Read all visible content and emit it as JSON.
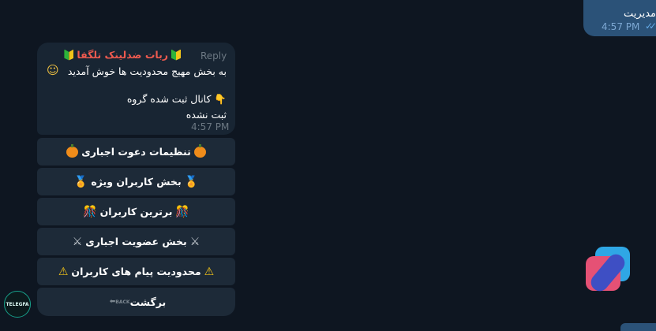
{
  "outgoing": {
    "text": "مدیریت",
    "time": "4:57 PM",
    "status": "read"
  },
  "avatar": {
    "label": "TELEGFA"
  },
  "message": {
    "reply_label": "Reply",
    "sender": "ربات ضدلینک تلگفا",
    "line1": "به بخش مهیج محدودیت ها خوش آمدید",
    "line2": "کانال ثبت شده گروه",
    "line3": "ثبت نشده",
    "time": "4:57 PM"
  },
  "keyboard": [
    {
      "label": "تنظیمات دعوت اجباری",
      "icon": "pumpkin-icon"
    },
    {
      "label": "بخش کاربران ویژه",
      "icon": "medal-icon"
    },
    {
      "label": "برترین کاربران",
      "icon": "confetti-icon"
    },
    {
      "label": "بخش عضویت اجباری",
      "icon": "crossed-swords-icon"
    },
    {
      "label": "محدودیت پیام های کاربران",
      "icon": "warning-icon"
    },
    {
      "label": "برگشت",
      "icon": "back-arrow-icon",
      "icon_text": "BACK"
    }
  ]
}
